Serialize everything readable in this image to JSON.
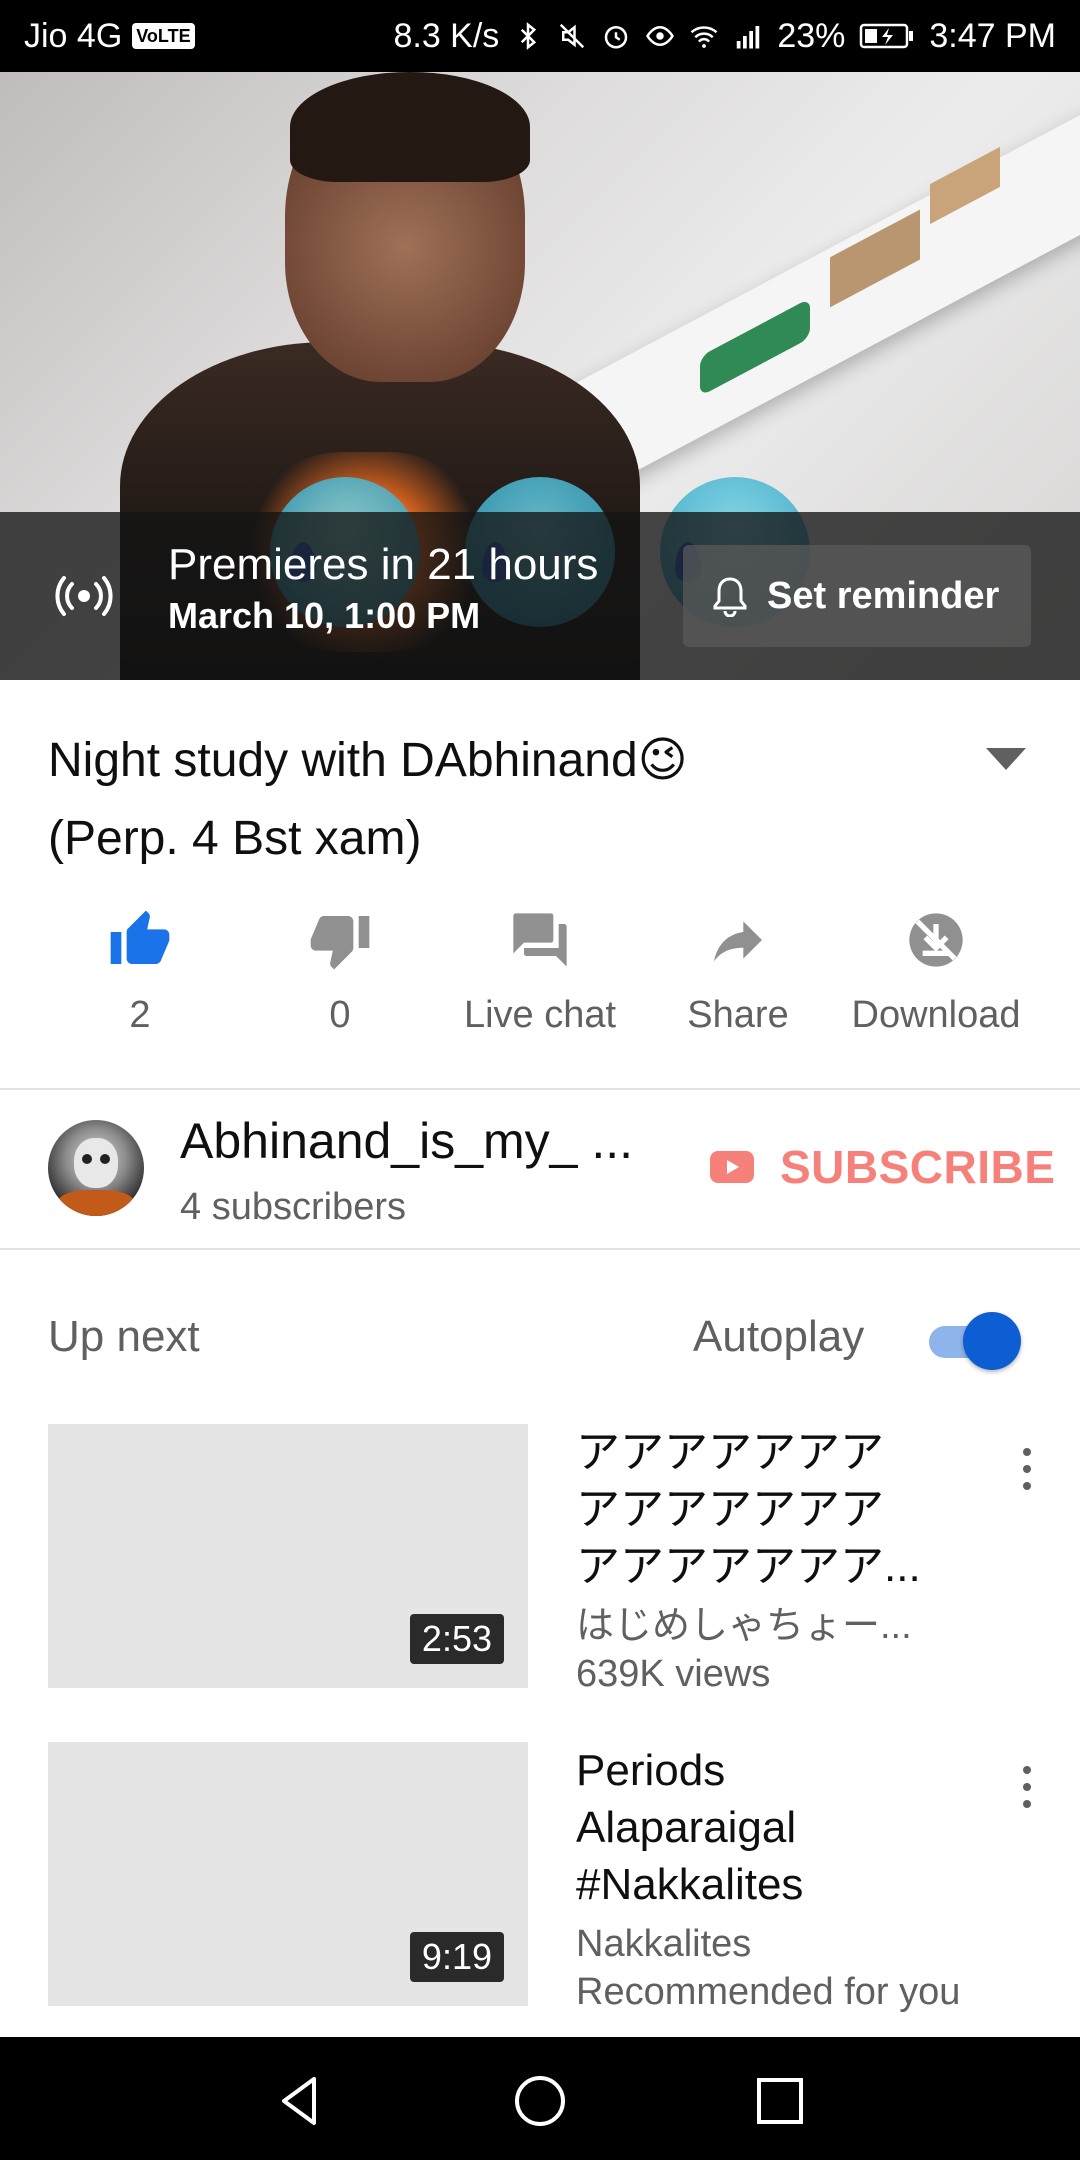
{
  "status_bar": {
    "carrier": "Jio 4G",
    "volte": "VoLTE",
    "speed": "8.3 K/s",
    "battery": "23%",
    "time": "3:47 PM"
  },
  "premiere": {
    "title": "Premieres in 21 hours",
    "date": "March 10, 1:00 PM",
    "reminder_label": "Set reminder"
  },
  "video": {
    "title_line1": "Night study with DAbhinand😉",
    "title_line2": "(Perp. 4 Bst xam)"
  },
  "actions": {
    "like_count": "2",
    "dislike_count": "0",
    "live_chat": "Live chat",
    "share": "Share",
    "download": "Download"
  },
  "channel": {
    "name": "Abhinand_is_my_ ...",
    "subscribers": "4 subscribers",
    "subscribe_label": "SUBSCRIBE"
  },
  "up_next": {
    "label": "Up next",
    "autoplay_label": "Autoplay",
    "autoplay_on": true
  },
  "recommendations": [
    {
      "title_lines": [
        "アアアアアアア",
        "アアアアアアア",
        "アアアアアアア..."
      ],
      "channel": "はじめしゃちょー...",
      "meta": "639K views",
      "duration": "2:53"
    },
    {
      "title_lines": [
        "Periods",
        "Alaparaigal",
        "#Nakkalites"
      ],
      "channel": "Nakkalites",
      "meta": "Recommended for you",
      "duration": "9:19"
    }
  ],
  "colors": {
    "like_active": "#1a73e8",
    "icon_grey": "#909090",
    "subscribe_red": "#f6807a",
    "toggle_blue": "#0e5ed3"
  }
}
